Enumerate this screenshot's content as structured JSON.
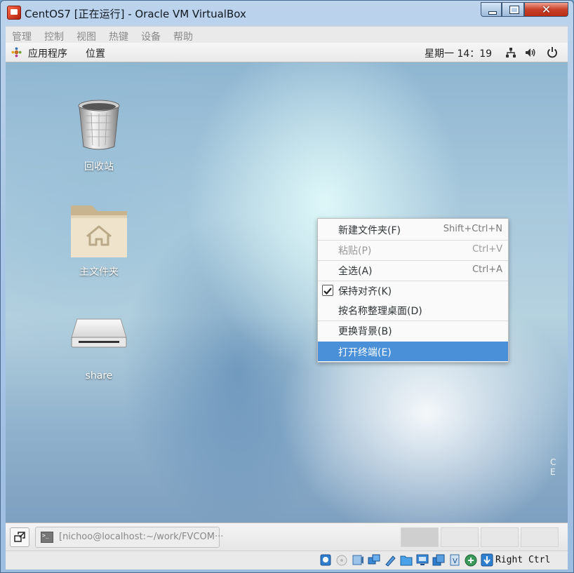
{
  "window": {
    "title": "CentOS7 [正在运行] - Oracle VM VirtualBox",
    "close_glyph": "✕"
  },
  "vbox_menu": {
    "items": [
      "管理",
      "控制",
      "视图",
      "热键",
      "设备",
      "帮助"
    ]
  },
  "gnome_top_panel": {
    "applications": "应用程序",
    "places": "位置",
    "clock": "星期一 14：19"
  },
  "desktop": {
    "icons": [
      {
        "label": "回收站",
        "icon": "trash-icon"
      },
      {
        "label": "主文件夹",
        "icon": "home-folder-icon"
      },
      {
        "label": "share",
        "icon": "drive-icon"
      }
    ],
    "edge_text": "C E"
  },
  "context_menu": {
    "items": [
      {
        "label": "新建文件夹(F)",
        "shortcut": "Shift+Ctrl+N",
        "state": "normal"
      },
      {
        "label": "粘贴(P)",
        "shortcut": "Ctrl+V",
        "state": "disabled"
      },
      {
        "label": "全选(A)",
        "shortcut": "Ctrl+A",
        "state": "normal"
      },
      {
        "label": "保持对齐(K)",
        "shortcut": "",
        "state": "checked"
      },
      {
        "label": "按名称整理桌面(D)",
        "shortcut": "",
        "state": "normal"
      },
      {
        "label": "更换背景(B)",
        "shortcut": "",
        "state": "normal"
      },
      {
        "label": "打开终端(E)",
        "shortcut": "",
        "state": "highlighted"
      }
    ]
  },
  "gnome_bottom_panel": {
    "task": "[nichoo@localhost:~/work/FVCOM···",
    "workspaces": 4,
    "current_workspace": 1
  },
  "vbox_status": {
    "icons": [
      "hard-disk-icon",
      "optical-drive-icon",
      "audio-icon",
      "network-icon",
      "usb-icon",
      "shared-folders-icon",
      "display-icon",
      "video-capture-icon",
      "cpu-icon",
      "mouse-integration-icon",
      "keyboard-icon"
    ],
    "host_key": "Right Ctrl"
  },
  "colors": {
    "menu_highlight": "#4a90d9",
    "close_button": "#c8412a"
  }
}
